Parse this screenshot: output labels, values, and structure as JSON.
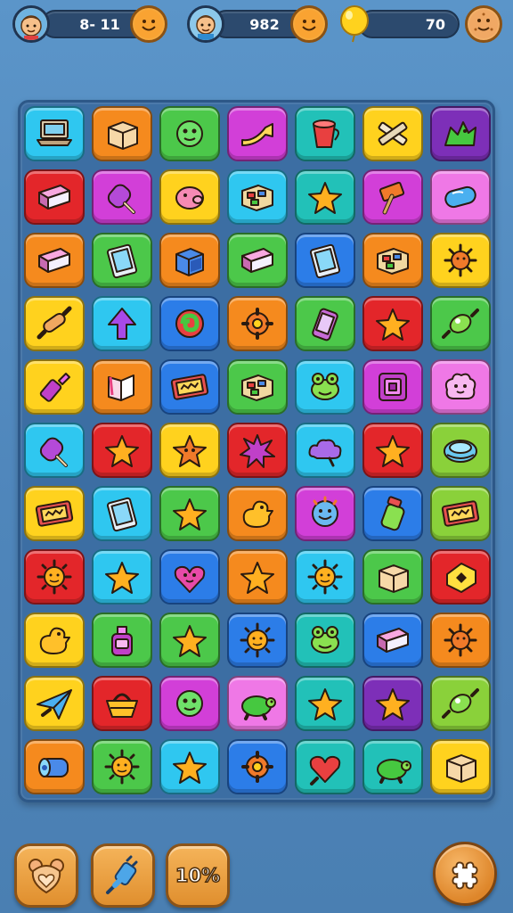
{
  "hud": {
    "left_value": "8- 11",
    "center_value": "982",
    "right_value": "70"
  },
  "colors": {
    "cyan": "#2fc7f0",
    "orange": "#f58a1e",
    "green": "#4cc84a",
    "magenta": "#d23fd8",
    "teal": "#22c1b8",
    "yellow": "#ffd21e",
    "purple": "#7d2fb8",
    "red": "#e3262a",
    "pink": "#ef78e6",
    "blue": "#2c7de8",
    "lime": "#8ad13a"
  },
  "board": {
    "rows": [
      [
        {
          "color": "cyan",
          "icon": "laptop-icon"
        },
        {
          "color": "orange",
          "icon": "box-icon"
        },
        {
          "color": "green",
          "icon": "creature-icon"
        },
        {
          "color": "magenta",
          "icon": "horn-icon"
        },
        {
          "color": "teal",
          "icon": "cup-icon"
        },
        {
          "color": "yellow",
          "icon": "crossed-sticks-icon"
        },
        {
          "color": "purple",
          "icon": "dragon-icon"
        }
      ],
      [
        {
          "color": "red",
          "icon": "book-icon"
        },
        {
          "color": "magenta",
          "icon": "popsicle-icon"
        },
        {
          "color": "yellow",
          "icon": "pig-icon"
        },
        {
          "color": "cyan",
          "icon": "treasure-box-icon"
        },
        {
          "color": "teal",
          "icon": "star-icon"
        },
        {
          "color": "magenta",
          "icon": "hammer-icon"
        },
        {
          "color": "pink",
          "icon": "capsule-icon"
        }
      ],
      [
        {
          "color": "orange",
          "icon": "book-icon"
        },
        {
          "color": "green",
          "icon": "tablet-icon"
        },
        {
          "color": "orange",
          "icon": "cube-icon"
        },
        {
          "color": "green",
          "icon": "book-icon"
        },
        {
          "color": "blue",
          "icon": "tablet-icon"
        },
        {
          "color": "orange",
          "icon": "treasure-box-icon"
        },
        {
          "color": "yellow",
          "icon": "sun-creature-icon"
        }
      ],
      [
        {
          "color": "yellow",
          "icon": "rolling-pin-icon"
        },
        {
          "color": "cyan",
          "icon": "arrow-up-icon"
        },
        {
          "color": "blue",
          "icon": "swirl-icon"
        },
        {
          "color": "orange",
          "icon": "gear-icon"
        },
        {
          "color": "green",
          "icon": "phone-icon"
        },
        {
          "color": "red",
          "icon": "star-icon"
        },
        {
          "color": "green",
          "icon": "candy-icon"
        }
      ],
      [
        {
          "color": "yellow",
          "icon": "lipstick-icon"
        },
        {
          "color": "orange",
          "icon": "open-book-icon"
        },
        {
          "color": "blue",
          "icon": "sign-icon"
        },
        {
          "color": "green",
          "icon": "treasure-box-icon"
        },
        {
          "color": "cyan",
          "icon": "frog-icon"
        },
        {
          "color": "magenta",
          "icon": "square-frame-icon"
        },
        {
          "color": "pink",
          "icon": "fluffy-creature-icon"
        }
      ],
      [
        {
          "color": "cyan",
          "icon": "popsicle-icon"
        },
        {
          "color": "red",
          "icon": "star-icon"
        },
        {
          "color": "yellow",
          "icon": "star-creature-icon"
        },
        {
          "color": "red",
          "icon": "burst-icon"
        },
        {
          "color": "cyan",
          "icon": "cloud-icon"
        },
        {
          "color": "red",
          "icon": "star-icon"
        },
        {
          "color": "lime",
          "icon": "disc-icon"
        }
      ],
      [
        {
          "color": "yellow",
          "icon": "sign-icon"
        },
        {
          "color": "cyan",
          "icon": "tablet-icon"
        },
        {
          "color": "green",
          "icon": "star-icon"
        },
        {
          "color": "orange",
          "icon": "duck-icon"
        },
        {
          "color": "magenta",
          "icon": "smile-face-icon"
        },
        {
          "color": "blue",
          "icon": "jar-icon"
        },
        {
          "color": "lime",
          "icon": "sign-icon"
        }
      ],
      [
        {
          "color": "red",
          "icon": "sun-icon"
        },
        {
          "color": "cyan",
          "icon": "star-icon"
        },
        {
          "color": "blue",
          "icon": "heart-face-icon"
        },
        {
          "color": "orange",
          "icon": "star-icon"
        },
        {
          "color": "cyan",
          "icon": "sun-icon"
        },
        {
          "color": "green",
          "icon": "box-icon"
        },
        {
          "color": "red",
          "icon": "tag-icon"
        }
      ],
      [
        {
          "color": "yellow",
          "icon": "duck-icon"
        },
        {
          "color": "green",
          "icon": "bottle-icon"
        },
        {
          "color": "green",
          "icon": "star-icon"
        },
        {
          "color": "blue",
          "icon": "sun-icon"
        },
        {
          "color": "teal",
          "icon": "frog-icon"
        },
        {
          "color": "blue",
          "icon": "book-icon"
        },
        {
          "color": "orange",
          "icon": "sun-creature-icon"
        }
      ],
      [
        {
          "color": "yellow",
          "icon": "paper-plane-icon"
        },
        {
          "color": "red",
          "icon": "basket-icon"
        },
        {
          "color": "magenta",
          "icon": "creature-icon"
        },
        {
          "color": "pink",
          "icon": "turtle-icon"
        },
        {
          "color": "teal",
          "icon": "star-icon"
        },
        {
          "color": "purple",
          "icon": "star-icon"
        },
        {
          "color": "lime",
          "icon": "candy-icon"
        }
      ],
      [
        {
          "color": "orange",
          "icon": "roll-icon"
        },
        {
          "color": "green",
          "icon": "sun-icon"
        },
        {
          "color": "cyan",
          "icon": "star-icon"
        },
        {
          "color": "blue",
          "icon": "gear-icon"
        },
        {
          "color": "teal",
          "icon": "heart-icon"
        },
        {
          "color": "teal",
          "icon": "turtle-icon"
        },
        {
          "color": "yellow",
          "icon": "box-icon"
        }
      ]
    ]
  },
  "bottom_bar": {
    "percent_label": "10%"
  }
}
